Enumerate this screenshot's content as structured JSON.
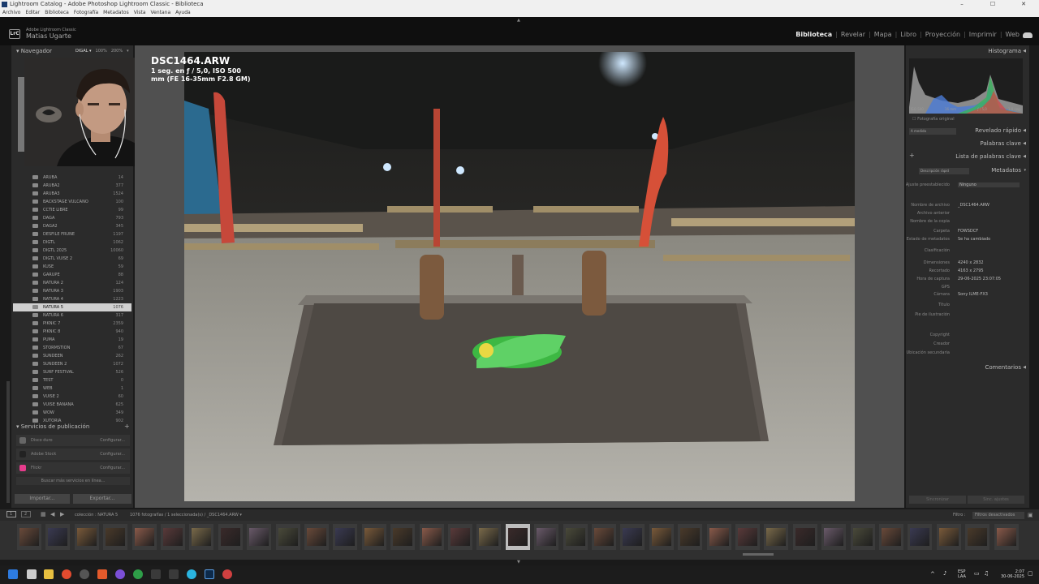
{
  "window": {
    "title": "Lightroom Catalog - Adobe Photoshop Lightroom Classic - Biblioteca",
    "controls": [
      "–",
      "☐",
      "✕"
    ]
  },
  "menu": [
    "Archivo",
    "Editar",
    "Biblioteca",
    "Fotografía",
    "Metadatos",
    "Vista",
    "Ventana",
    "Ayuda"
  ],
  "identity": {
    "logo": "LrC",
    "small": "Adobe Lightroom Classic",
    "name": "Matias Ugarte"
  },
  "modules": [
    "Biblioteca",
    "Revelar",
    "Mapa",
    "Libro",
    "Proyección",
    "Imprimir",
    "Web"
  ],
  "active_module": "Biblioteca",
  "left_panel": {
    "navigator_title": "Navegador",
    "navigator_options": [
      "DIGAL ▾",
      "100%",
      "200%",
      "▾"
    ],
    "folders": [
      {
        "name": "ARUBA",
        "count": "14"
      },
      {
        "name": "ARUBA2",
        "count": "377"
      },
      {
        "name": "ARUBA3",
        "count": "1524"
      },
      {
        "name": "BACKSTAGE VULCANO",
        "count": "100"
      },
      {
        "name": "CCTIE LIBRE",
        "count": "99"
      },
      {
        "name": "DAGA",
        "count": "793"
      },
      {
        "name": "DAGA2",
        "count": "345"
      },
      {
        "name": "DESFILE FRUNE",
        "count": "1197"
      },
      {
        "name": "DIGTL",
        "count": "1062"
      },
      {
        "name": "DIGTL 2025",
        "count": "10060"
      },
      {
        "name": "DIGTL VUISE 2",
        "count": "69"
      },
      {
        "name": "KUSE",
        "count": "59"
      },
      {
        "name": "GARUPE",
        "count": "88"
      },
      {
        "name": "NATURA 2",
        "count": "124"
      },
      {
        "name": "NATURA 3",
        "count": "1903"
      },
      {
        "name": "NATURA 4",
        "count": "1223"
      },
      {
        "name": "NATURA 5",
        "count": "1076"
      },
      {
        "name": "NATURA 6",
        "count": "317"
      },
      {
        "name": "PIKNIC 7",
        "count": "2359"
      },
      {
        "name": "PIKNIC 8",
        "count": "940"
      },
      {
        "name": "PUMA",
        "count": "19"
      },
      {
        "name": "STORMSTION",
        "count": "67"
      },
      {
        "name": "SUNDEEN",
        "count": "262"
      },
      {
        "name": "SUNDEEN 2",
        "count": "1072"
      },
      {
        "name": "SURF FESTIVAL",
        "count": "526"
      },
      {
        "name": "TEST",
        "count": "0"
      },
      {
        "name": "WEB",
        "count": "1"
      },
      {
        "name": "VUISE 2",
        "count": "60"
      },
      {
        "name": "VUISE BANANA",
        "count": "625"
      },
      {
        "name": "WOW",
        "count": "349"
      },
      {
        "name": "XUTORIA",
        "count": "902"
      }
    ],
    "selected_folder": 16,
    "publish_title": "Servicios de publicación",
    "publish_services": [
      {
        "label": "Disco duro",
        "action": "Configurar...",
        "color": "#666666"
      },
      {
        "label": "Adobe Stock",
        "action": "Configurar...",
        "color": "#222222"
      },
      {
        "label": "Flickr",
        "action": "Configurar...",
        "color": "#e63c8c"
      }
    ],
    "find_more": "Buscar más servicios en línea...",
    "import_label": "Importar...",
    "export_label": "Exportar..."
  },
  "photo_info": {
    "filename": "DSC1464.ARW",
    "exposure": "1 seg. en ƒ / 5,0, ISO 500",
    "lens": "mm (FE 16-35mm F2.8 GM)"
  },
  "right_panel": {
    "histogram_title": "Histograma",
    "histogram_labels": [
      "ISO 500",
      "16 mm",
      "ƒ / 5,0",
      "1,0 seg."
    ],
    "original_photo": "Fotografía original",
    "quick_develop_preset": "A medida",
    "quick_develop": "Revelado rápido",
    "keywords": "Palabras clave",
    "keyword_list": "Lista de palabras clave",
    "metadata_preset": "Descripción rápid",
    "metadata": "Metadatos",
    "preset_label": "Ajuste preestablecido",
    "preset_value": "Ninguno",
    "meta_rows": [
      {
        "label": "Nombre de archivo",
        "value": "_DSC1464.ARW"
      },
      {
        "label": "Archivo anterior",
        "value": ""
      },
      {
        "label": "Nombre de la copia",
        "value": ""
      },
      {
        "label": "Carpeta",
        "value": "FOWSDCF"
      },
      {
        "label": "Estado de metadatos",
        "value": "Se ha cambiado"
      },
      {
        "label": "Clasificación",
        "value": ""
      },
      {
        "label": "Dimensiones",
        "value": "4240 x 2832"
      },
      {
        "label": "Recortado",
        "value": "4163 x 2795"
      },
      {
        "label": "Hora de captura",
        "value": "29-06-2025 23:07:05"
      },
      {
        "label": "GPS",
        "value": ""
      },
      {
        "label": "Cámara",
        "value": "Sony ILME-FX3"
      },
      {
        "label": "Título",
        "value": ""
      },
      {
        "label": "Pie de ilustración",
        "value": ""
      },
      {
        "label": "Copyright",
        "value": ""
      },
      {
        "label": "Creador",
        "value": ""
      },
      {
        "label": "Ubicación secundaria",
        "value": ""
      }
    ],
    "comments": "Comentarios",
    "sync_metadata": "Sincronizar",
    "sync_settings": "Sinc. ajustes"
  },
  "toolbar": {
    "pages": [
      "1",
      "2"
    ],
    "source": "colección : NATURA 5",
    "count": "1076 fotografías / 1 seleccionada(s) / _DSC1464.ARW ▾",
    "filter_label": "Filtro :",
    "filter_value": "Filtros desactivados"
  },
  "taskbar": {
    "lang": "ESP",
    "lang2": "LAA",
    "time": "2:07",
    "date": "30-06-2025"
  },
  "colors": {
    "panel": "#2b2b2b",
    "background": "#505050",
    "histogram_blue": "#4a7ad6",
    "histogram_green": "#39b45c",
    "histogram_red": "#d64545"
  }
}
